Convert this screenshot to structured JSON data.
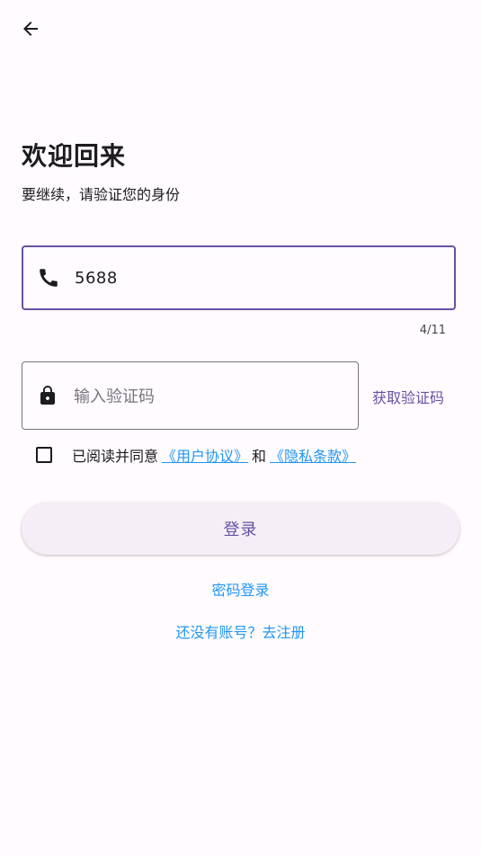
{
  "header": {
    "back_icon": "arrow-left-icon"
  },
  "welcome": {
    "title": "欢迎回来",
    "subtitle": "要继续，请验证您的身份"
  },
  "phone": {
    "icon": "phone-icon",
    "value": "5688",
    "counter": "4/11"
  },
  "code": {
    "icon": "lock-icon",
    "placeholder": "输入验证码",
    "get_code_label": "获取验证码"
  },
  "agreement": {
    "checked": false,
    "text": "已阅读并同意",
    "user_agreement": "《用户协议》",
    "and": "和",
    "privacy_policy": "《隐私条款》"
  },
  "actions": {
    "login_label": "登录",
    "password_login": "密码登录",
    "register": "还没有账号？去注册"
  },
  "colors": {
    "primary": "#6750a4",
    "link": "#2196f3",
    "background": "#fffbfe"
  }
}
